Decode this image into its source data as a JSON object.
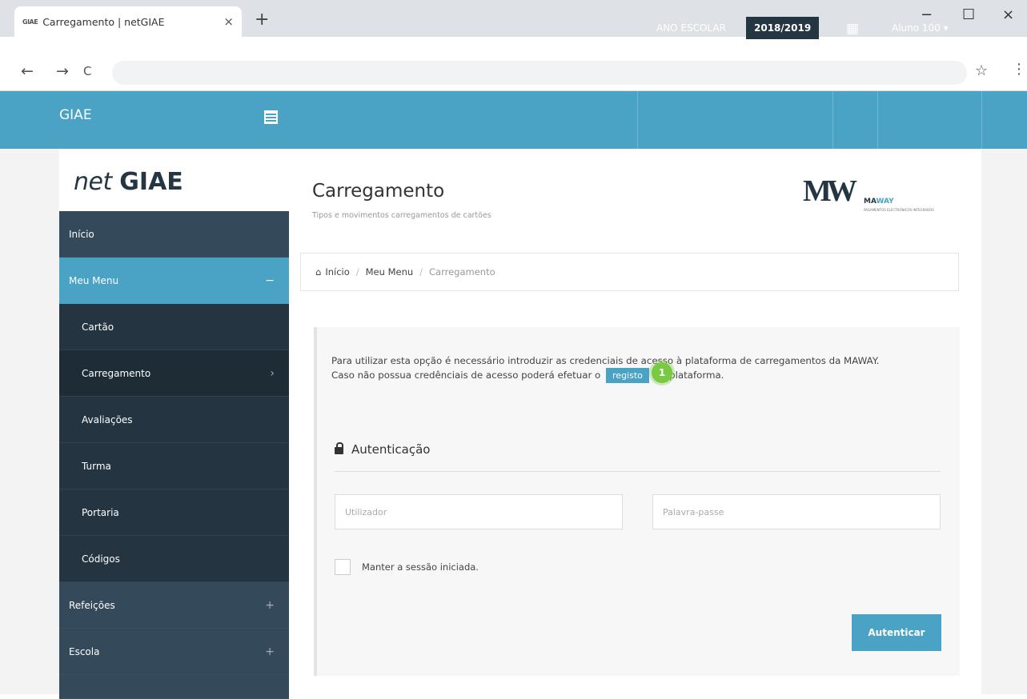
{
  "browser": {
    "tab_favicon": "GIAE",
    "tab_title": "Carregamento | netGIAE",
    "tab_close": "×",
    "new_tab": "+",
    "minimize": "−",
    "maximize": "☐",
    "close": "×",
    "back": "←",
    "forward": "→",
    "reload": "C",
    "bookmark": "☆",
    "menu": "⋮"
  },
  "header": {
    "brand": "GIAE",
    "ano_label": "ANO ESCOLAR",
    "ano_value": "2018/2019",
    "grid_icon": "▦",
    "user": "Aluno 100 ▾"
  },
  "sidebar": {
    "logo_net": "net",
    "logo_giae": "GIAE",
    "items": [
      {
        "label": "Início",
        "symbol": ""
      },
      {
        "label": "Meu Menu",
        "symbol": "−"
      },
      {
        "label": "Cartão",
        "symbol": ""
      },
      {
        "label": "Carregamento",
        "symbol": "›"
      },
      {
        "label": "Avaliações",
        "symbol": ""
      },
      {
        "label": "Turma",
        "symbol": ""
      },
      {
        "label": "Portaria",
        "symbol": ""
      },
      {
        "label": "Códigos",
        "symbol": ""
      },
      {
        "label": "Refeições",
        "symbol": "+"
      },
      {
        "label": "Escola",
        "symbol": "+"
      }
    ]
  },
  "main": {
    "title": "Carregamento",
    "subtitle": "Tipos e movimentos carregamentos de cartões",
    "maway_mark": "MW",
    "maway_name_a": "MA",
    "maway_name_b": "WAY",
    "maway_slogan": "PAGAMENTOS ELECTRÓNICOS INTEGRADOS",
    "breadcrumb": {
      "home": "Início",
      "sep": "/",
      "menu": "Meu Menu",
      "current": "Carregamento"
    },
    "info_line1": "Para utilizar esta opção é necessário introduzir as credenciais de acesso à plataforma de carregamentos da MAWAY.",
    "info_line2_pre": "Caso não possua credênciais de acesso poderá efetuar o",
    "registo": "registo",
    "info_line2_post": "na plataforma.",
    "badge": "1",
    "auth_title": "Autenticação",
    "user_placeholder": "Utilizador",
    "pass_placeholder": "Palavra-passe",
    "remember": "Manter a sessão iniciada.",
    "submit": "Autenticar"
  },
  "colors": {
    "accent": "#4aa3c4",
    "dark": "#243642",
    "badge": "#7ac943"
  }
}
